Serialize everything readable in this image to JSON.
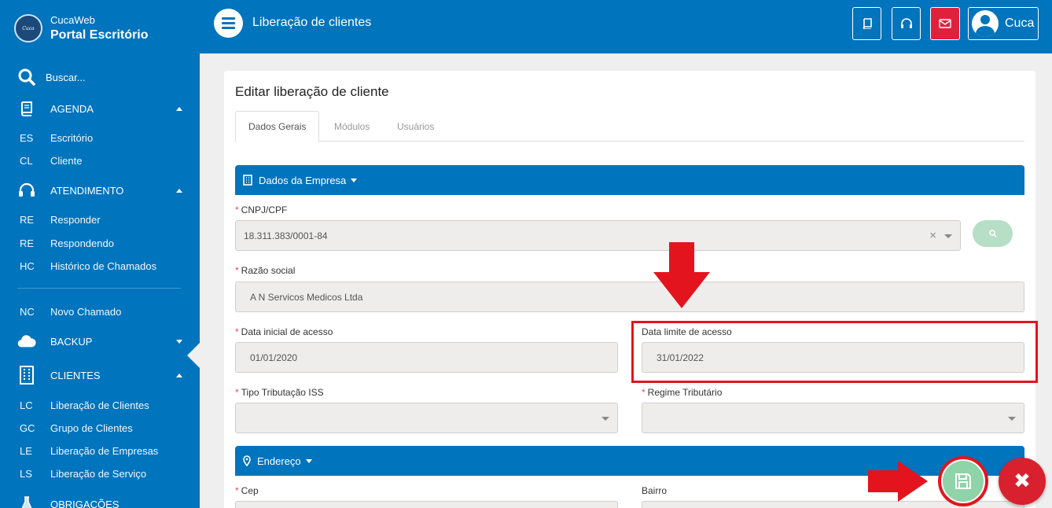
{
  "brand": {
    "small": "CucaWeb",
    "big": "Portal Escritório"
  },
  "header": {
    "title": "Liberação de clientes",
    "user_name": "Cuca"
  },
  "sidebar": {
    "search_placeholder": "Buscar...",
    "sections": [
      {
        "label": "AGENDA",
        "icon": "book-icon",
        "expanded": true
      },
      {
        "label": "ATENDIMENTO",
        "icon": "headset-icon",
        "expanded": true
      },
      {
        "label": "BACKUP",
        "icon": "cloud-icon",
        "expanded": false
      },
      {
        "label": "CLIENTES",
        "icon": "building-icon",
        "expanded": true
      },
      {
        "label": "OBRIGAÇÕES",
        "icon": "flask-icon",
        "expanded": false
      }
    ],
    "items": [
      {
        "abbr": "ES",
        "label": "Escritório"
      },
      {
        "abbr": "CL",
        "label": "Cliente"
      },
      {
        "abbr": "RE",
        "label": "Responder"
      },
      {
        "abbr": "RE",
        "label": "Respondendo"
      },
      {
        "abbr": "HC",
        "label": "Histórico de Chamados"
      },
      {
        "abbr": "NC",
        "label": "Novo Chamado"
      },
      {
        "abbr": "LC",
        "label": "Liberação de Clientes"
      },
      {
        "abbr": "GC",
        "label": "Grupo de Clientes"
      },
      {
        "abbr": "LE",
        "label": "Liberação de Empresas"
      },
      {
        "abbr": "LS",
        "label": "Liberação de Serviço"
      }
    ],
    "active_item": "Liberação de Clientes"
  },
  "card": {
    "title": "Editar liberação de cliente",
    "tabs": [
      "Dados Gerais",
      "Módulos",
      "Usuários"
    ],
    "active_tab": "Dados Gerais"
  },
  "sections": {
    "empresa": "Dados da Empresa",
    "endereco": "Endereço"
  },
  "form": {
    "cnpj_label": "CNPJ/CPF",
    "cnpj_value": "18.311.383/0001-84",
    "razao_label": "Razão social",
    "razao_value": "A N Servicos Medicos Ltda",
    "data_inicial_label": "Data inicial de acesso",
    "data_inicial_value": "01/01/2020",
    "data_limite_label": "Data limite de acesso",
    "data_limite_value": "31/01/2022",
    "tipo_iss_label": "Tipo Tributação ISS",
    "tipo_iss_value": "",
    "regime_label": "Regime Tributário",
    "regime_value": "",
    "cep_label": "Cep",
    "bairro_label": "Bairro",
    "required_mark": "*"
  },
  "colors": {
    "primary": "#0074bd",
    "danger": "#e3141e",
    "success_light": "#8fd3a8",
    "background": "#efefef"
  }
}
